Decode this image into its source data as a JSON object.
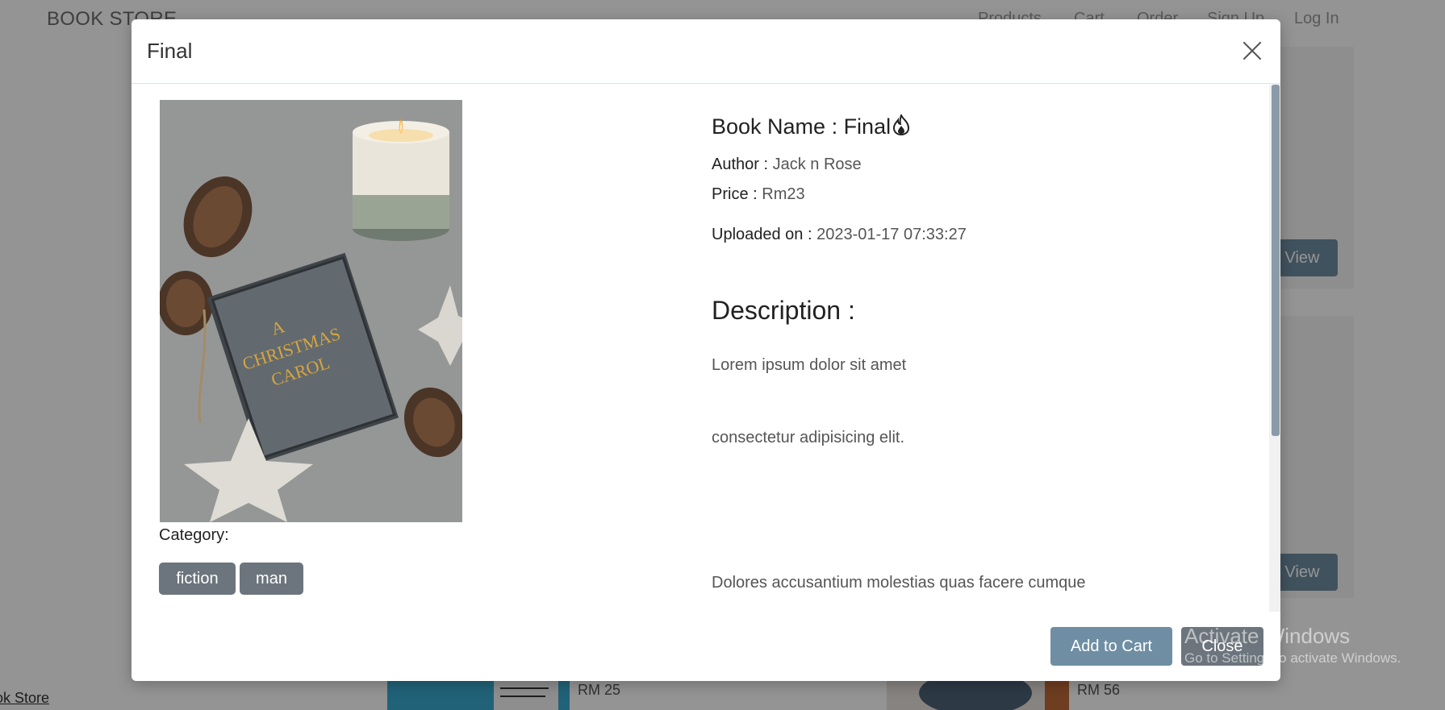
{
  "background": {
    "brand": "BOOK STORE",
    "nav": [
      "Products",
      "Cart",
      "Order",
      "Sign Up",
      "Log In"
    ],
    "view_button_label": "View",
    "prices": [
      "RM 25",
      "RM 56"
    ],
    "footer_link": "ok Store"
  },
  "watermark": {
    "title": "Activate Windows",
    "subtitle": "Go to Settings to activate Windows."
  },
  "modal": {
    "title": "Final",
    "book_name_label": "Book Name : Final",
    "author_label": "Author : ",
    "author_value": "Jack n Rose",
    "price_label": "Price : ",
    "price_value": "Rm23",
    "uploaded_label": "Uploaded on : ",
    "uploaded_value": "2023-01-17 07:33:27",
    "description_title": "Description :",
    "description_paragraphs": [
      "Lorem ipsum dolor sit amet",
      "consectetur adipisicing elit.",
      "Dolores accusantium molestias quas facere cumque"
    ],
    "category_label": "Category:",
    "categories": [
      "fiction",
      "man"
    ],
    "cover_title": [
      "A",
      "CHRISTMAS",
      "CAROL"
    ],
    "add_to_cart_label": "Add to Cart",
    "close_label": "Close"
  },
  "colors": {
    "primary_button": "#6f8ea3",
    "secondary_button": "#6c757d"
  }
}
